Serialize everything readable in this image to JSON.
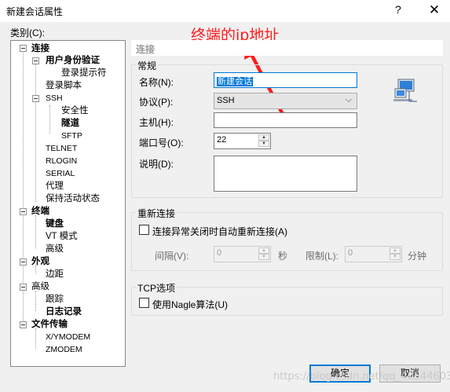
{
  "window": {
    "title": "新建会话属性",
    "help": "?",
    "close": "✕"
  },
  "annotation": "终端的ip地址",
  "category_label": "类别(C):",
  "tree": {
    "items": [
      {
        "label": "连接",
        "bold": true
      },
      {
        "label": "用户身份验证",
        "bold": true
      },
      {
        "label": "登录提示符",
        "bold": false
      },
      {
        "label": "登录脚本",
        "bold": false
      },
      {
        "label": "SSH",
        "bold": false
      },
      {
        "label": "安全性",
        "bold": false
      },
      {
        "label": "隧道",
        "bold": true
      },
      {
        "label": "SFTP",
        "bold": false
      },
      {
        "label": "TELNET",
        "bold": false
      },
      {
        "label": "RLOGIN",
        "bold": false
      },
      {
        "label": "SERIAL",
        "bold": false
      },
      {
        "label": "代理",
        "bold": false
      },
      {
        "label": "保持活动状态",
        "bold": false
      },
      {
        "label": "终端",
        "bold": true
      },
      {
        "label": "键盘",
        "bold": true
      },
      {
        "label": "VT 模式",
        "bold": false
      },
      {
        "label": "高级",
        "bold": false
      },
      {
        "label": "外观",
        "bold": true
      },
      {
        "label": "边距",
        "bold": false
      },
      {
        "label": "高级",
        "bold": false
      },
      {
        "label": "跟踪",
        "bold": false
      },
      {
        "label": "日志记录",
        "bold": true
      },
      {
        "label": "文件传输",
        "bold": true
      },
      {
        "label": "X/YMODEM",
        "bold": false
      },
      {
        "label": "ZMODEM",
        "bold": false
      }
    ]
  },
  "section_header": "连接",
  "general": {
    "group_label": "常规",
    "name_label": "名称(N):",
    "name_value": "新建会话",
    "protocol_label": "协议(P):",
    "protocol_value": "SSH",
    "host_label": "主机(H):",
    "host_value": "",
    "port_label": "端口号(O):",
    "port_value": "22",
    "desc_label": "说明(D):",
    "desc_value": ""
  },
  "reconnect": {
    "group_label": "重新连接",
    "checkbox_label": "连接异常关闭时自动重新连接(A)",
    "interval_label": "间隔(V):",
    "interval_value": "0",
    "interval_unit": "秒",
    "limit_label": "限制(L):",
    "limit_value": "0",
    "limit_unit": "分钟"
  },
  "tcp": {
    "group_label": "TCP选项",
    "nagle_label": "使用Nagle算法(U)"
  },
  "buttons": {
    "ok": "确定",
    "cancel": "取消"
  },
  "watermark": "https://blog.csdn.net/qq_40544603"
}
